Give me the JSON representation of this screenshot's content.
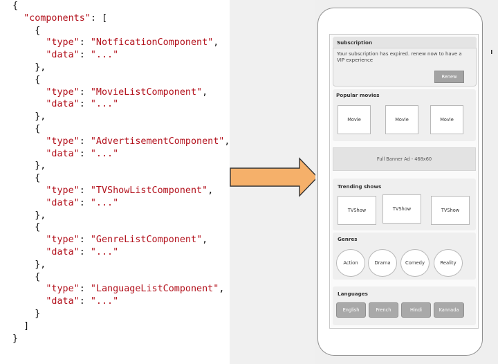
{
  "code": {
    "lines": [
      [
        [
          "pun",
          "{"
        ]
      ],
      [
        [
          "pun",
          "  "
        ],
        [
          "key",
          "\"components\""
        ],
        [
          "pun",
          ": ["
        ]
      ],
      [
        [
          "pun",
          "    {"
        ]
      ],
      [
        [
          "pun",
          "      "
        ],
        [
          "key",
          "\"type\""
        ],
        [
          "pun",
          ": "
        ],
        [
          "str",
          "\"NotficationComponent\""
        ],
        [
          "pun",
          ","
        ]
      ],
      [
        [
          "pun",
          "      "
        ],
        [
          "key",
          "\"data\""
        ],
        [
          "pun",
          ": "
        ],
        [
          "str",
          "\"...\""
        ]
      ],
      [
        [
          "pun",
          "    },"
        ]
      ],
      [
        [
          "pun",
          "    {"
        ]
      ],
      [
        [
          "pun",
          "      "
        ],
        [
          "key",
          "\"type\""
        ],
        [
          "pun",
          ": "
        ],
        [
          "str",
          "\"MovieListComponent\""
        ],
        [
          "pun",
          ","
        ]
      ],
      [
        [
          "pun",
          "      "
        ],
        [
          "key",
          "\"data\""
        ],
        [
          "pun",
          ": "
        ],
        [
          "str",
          "\"...\""
        ]
      ],
      [
        [
          "pun",
          "    },"
        ]
      ],
      [
        [
          "pun",
          "    {"
        ]
      ],
      [
        [
          "pun",
          "      "
        ],
        [
          "key",
          "\"type\""
        ],
        [
          "pun",
          ": "
        ],
        [
          "str",
          "\"AdvertisementComponent\""
        ],
        [
          "pun",
          ","
        ]
      ],
      [
        [
          "pun",
          "      "
        ],
        [
          "key",
          "\"data\""
        ],
        [
          "pun",
          ": "
        ],
        [
          "str",
          "\"...\""
        ]
      ],
      [
        [
          "pun",
          "    },"
        ]
      ],
      [
        [
          "pun",
          "    {"
        ]
      ],
      [
        [
          "pun",
          "      "
        ],
        [
          "key",
          "\"type\""
        ],
        [
          "pun",
          ": "
        ],
        [
          "str",
          "\"TVShowListComponent\""
        ],
        [
          "pun",
          ","
        ]
      ],
      [
        [
          "pun",
          "      "
        ],
        [
          "key",
          "\"data\""
        ],
        [
          "pun",
          ": "
        ],
        [
          "str",
          "\"...\""
        ]
      ],
      [
        [
          "pun",
          "    },"
        ]
      ],
      [
        [
          "pun",
          "    {"
        ]
      ],
      [
        [
          "pun",
          "      "
        ],
        [
          "key",
          "\"type\""
        ],
        [
          "pun",
          ": "
        ],
        [
          "str",
          "\"GenreListComponent\""
        ],
        [
          "pun",
          ","
        ]
      ],
      [
        [
          "pun",
          "      "
        ],
        [
          "key",
          "\"data\""
        ],
        [
          "pun",
          ": "
        ],
        [
          "str",
          "\"...\""
        ]
      ],
      [
        [
          "pun",
          "    },"
        ]
      ],
      [
        [
          "pun",
          "    {"
        ]
      ],
      [
        [
          "pun",
          "      "
        ],
        [
          "key",
          "\"type\""
        ],
        [
          "pun",
          ": "
        ],
        [
          "str",
          "\"LanguageListComponent\""
        ],
        [
          "pun",
          ","
        ]
      ],
      [
        [
          "pun",
          "      "
        ],
        [
          "key",
          "\"data\""
        ],
        [
          "pun",
          ": "
        ],
        [
          "str",
          "\"...\""
        ]
      ],
      [
        [
          "pun",
          "    }"
        ]
      ],
      [
        [
          "pun",
          "  ]"
        ]
      ],
      [
        [
          "pun",
          "}"
        ]
      ]
    ]
  },
  "colors": {
    "code_key": "#b3121d",
    "arrow_fill": "#f5b06a",
    "arrow_stroke": "#333333"
  },
  "phone": {
    "subscription": {
      "title": "Subscription",
      "message": "Your subscription has expired. renew now to have a VIP experience",
      "button": "Renew"
    },
    "popular_movies": {
      "title": "Popular movies",
      "items": [
        "Movie",
        "Movie",
        "Movie"
      ]
    },
    "banner": "Full Banner Ad - 468x60",
    "trending_shows": {
      "title": "Trending shows",
      "items": [
        "TVShow",
        "TVShow",
        "TVShow"
      ]
    },
    "genres": {
      "title": "Genres",
      "items": [
        "Action",
        "Drama",
        "Comedy",
        "Reality"
      ]
    },
    "languages": {
      "title": "Languages",
      "items": [
        "English",
        "French",
        "Hindi",
        "Kannada"
      ]
    }
  }
}
